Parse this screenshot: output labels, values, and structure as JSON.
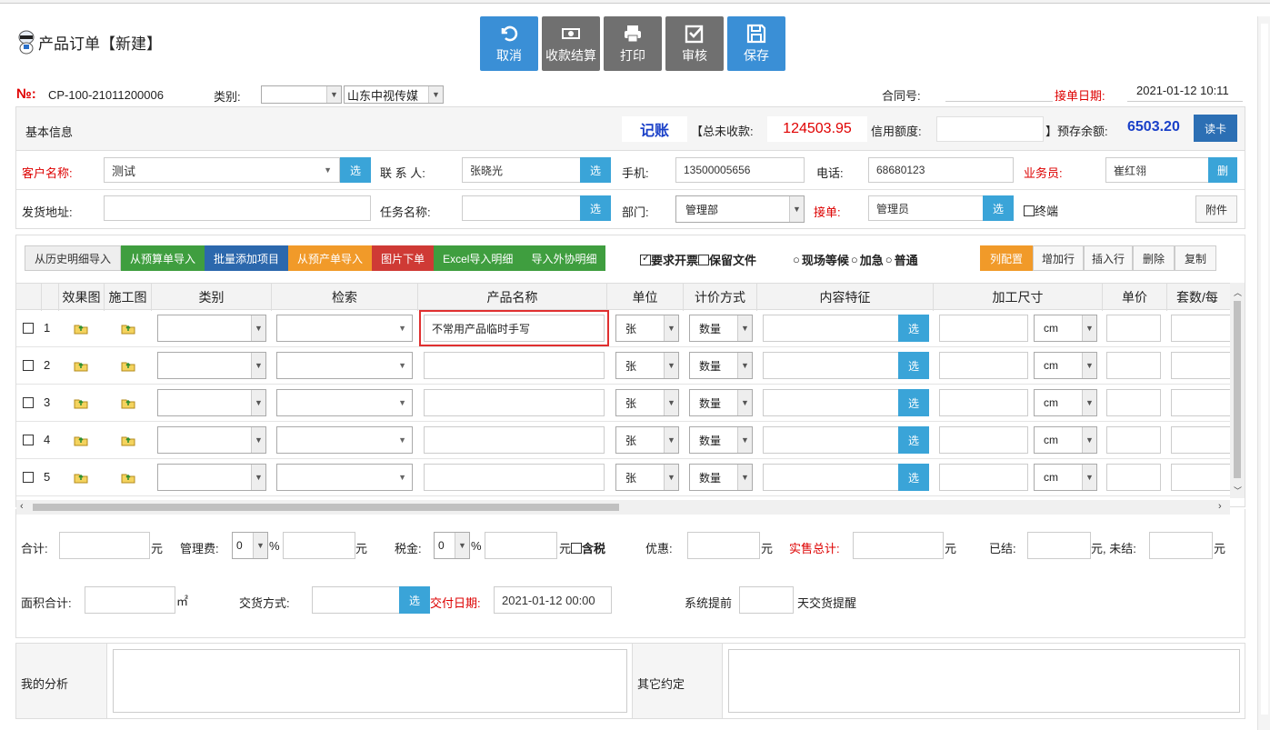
{
  "header": {
    "title": "产品订单【新建】"
  },
  "toolbar": {
    "cancel": "取消",
    "settle": "收款结算",
    "print": "打印",
    "audit": "审核",
    "save": "保存"
  },
  "order": {
    "no_label": "№:",
    "no_value": "CP-100-21011200006",
    "category_label": "类别:",
    "category_value": "",
    "company_value": "山东中视传媒",
    "contract_label": "合同号:",
    "contract_value": "",
    "date_label": "接单日期:",
    "date_value": "2021-01-12 10:11"
  },
  "basic": {
    "title": "基本信息",
    "bookkeep": "记账",
    "total_unpaid_label": "【总未收款:",
    "total_unpaid_value": "124503.95",
    "credit_label": "信用额度:",
    "credit_value": "",
    "prepaid_label": "】预存余额:",
    "prepaid_value": "6503.20",
    "read_card": "读卡",
    "customer_label": "客户名称:",
    "customer_value": "测试",
    "contact_label": "联 系 人:",
    "contact_value": "张晓光",
    "mobile_label": "手机:",
    "mobile_value": "13500005656",
    "phone_label": "电话:",
    "phone_value": "68680123",
    "salesman_label": "业务员:",
    "salesman_value": "崔红翎",
    "delete_btn": "删",
    "address_label": "发货地址:",
    "address_value": "",
    "task_label": "任务名称:",
    "task_value": "",
    "dept_label": "部门:",
    "dept_value": "管理部",
    "receiver_label": "接单:",
    "receiver_value": "管理员",
    "terminal_label": "终端",
    "attach": "附件",
    "select_btn": "选"
  },
  "imports": {
    "history": "从历史明细导入",
    "budget": "从预算单导入",
    "batch": "批量添加项目",
    "preprod": "从预产单导入",
    "picture": "图片下单",
    "excel": "Excel导入明细",
    "outsource": "导入外协明细",
    "invoice": "要求开票",
    "keepfile": "保留文件",
    "r1": "现场等候",
    "r2": "加急",
    "r3": "普通",
    "colconf": "列配置",
    "addrow": "增加行",
    "insrow": "插入行",
    "delrow": "删除",
    "copy": "复制"
  },
  "grid": {
    "headers": [
      "效果图",
      "施工图",
      "类别",
      "检索",
      "产品名称",
      "单位",
      "计价方式",
      "内容特征",
      "加工尺寸",
      "单价",
      "套数/每"
    ],
    "rows": [
      {
        "n": "1",
        "product": "不常用产品临时手写",
        "unit": "张",
        "price_mode": "数量",
        "size_unit": "cm"
      },
      {
        "n": "2",
        "product": "",
        "unit": "张",
        "price_mode": "数量",
        "size_unit": "cm"
      },
      {
        "n": "3",
        "product": "",
        "unit": "张",
        "price_mode": "数量",
        "size_unit": "cm"
      },
      {
        "n": "4",
        "product": "",
        "unit": "张",
        "price_mode": "数量",
        "size_unit": "cm"
      },
      {
        "n": "5",
        "product": "",
        "unit": "张",
        "price_mode": "数量",
        "size_unit": "cm"
      }
    ],
    "select_btn": "选",
    "highlight_color": "#e03030"
  },
  "totals": {
    "sum_label": "合计:",
    "yuan": "元",
    "mgmt_label": "管理费:",
    "mgmt_value": "0",
    "pct": "%",
    "tax_label": "税金:",
    "tax_value": "0",
    "taxinc": "含税",
    "discount_label": "优惠:",
    "sales_total_label": "实售总计:",
    "paid_label": "已结:",
    "unpaid_label": "元, 未结:",
    "area_label": "面积合计:",
    "area_unit": "㎡",
    "delivery_label": "交货方式:",
    "deliver_date_label": "交付日期:",
    "deliver_date_value": "2021-01-12 00:00",
    "remind_label": "系统提前",
    "remind_suffix": "天交货提醒"
  },
  "notes": {
    "my_analysis": "我的分析",
    "other": "其它约定"
  }
}
